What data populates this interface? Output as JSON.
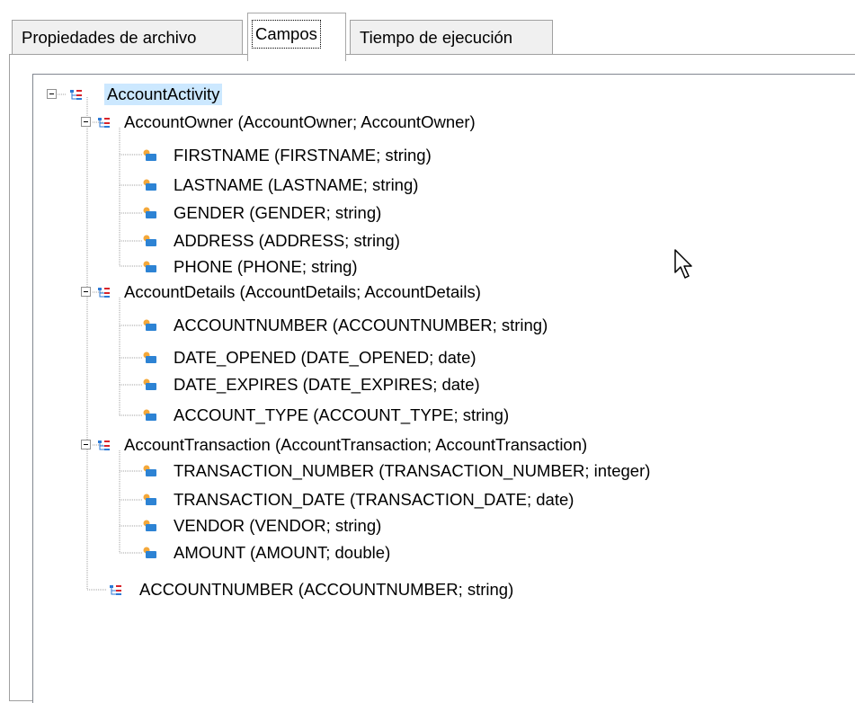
{
  "tabs": [
    {
      "label": "Propiedades de archivo",
      "active": false
    },
    {
      "label": "Campos",
      "active": true
    },
    {
      "label": "Tiempo de ejecución",
      "active": false
    }
  ],
  "tree": {
    "root": {
      "label": "AccountActivity",
      "icon": "record-icon",
      "selected": true
    },
    "groups": [
      {
        "label": "AccountOwner (AccountOwner; AccountOwner)",
        "icon": "record-icon",
        "fields": [
          "FIRSTNAME (FIRSTNAME; string)",
          "LASTNAME (LASTNAME; string)",
          "GENDER (GENDER; string)",
          "ADDRESS (ADDRESS; string)",
          "PHONE (PHONE; string)"
        ]
      },
      {
        "label": "AccountDetails (AccountDetails; AccountDetails)",
        "icon": "record-icon",
        "fields": [
          "ACCOUNTNUMBER (ACCOUNTNUMBER; string)",
          "DATE_OPENED (DATE_OPENED; date)",
          "DATE_EXPIRES (DATE_EXPIRES; date)",
          "ACCOUNT_TYPE (ACCOUNT_TYPE; string)"
        ]
      },
      {
        "label": "AccountTransaction (AccountTransaction; AccountTransaction)",
        "icon": "record-icon",
        "fields": [
          "TRANSACTION_NUMBER (TRANSACTION_NUMBER; integer)",
          "TRANSACTION_DATE (TRANSACTION_DATE; date)",
          "VENDOR (VENDOR; string)",
          "AMOUNT (AMOUNT; double)"
        ]
      }
    ],
    "trailing": {
      "label": "ACCOUNTNUMBER (ACCOUNTNUMBER; string)",
      "icon": "record-icon"
    }
  },
  "icons": {
    "field": "field-icon",
    "record": "record-icon"
  },
  "colors": {
    "selection": "#cce8ff",
    "tab_border": "#a0a0a0",
    "guide_dots": "#a0a0a0"
  }
}
